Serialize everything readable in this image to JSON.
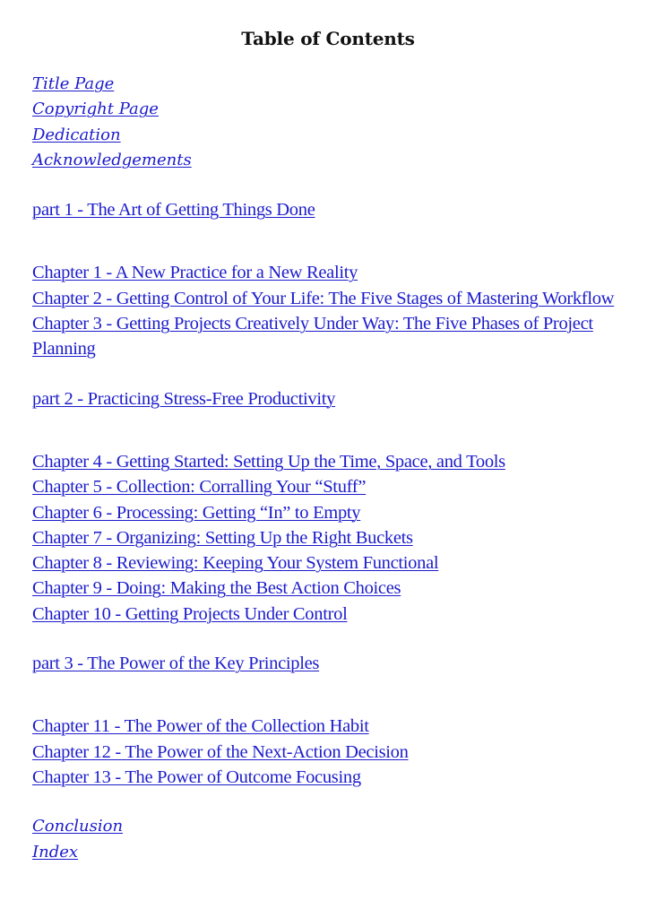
{
  "title": "Table of Contents",
  "link_color": "#1c1ccc",
  "front_matter": [
    "Title Page",
    "Copyright Page",
    "Dedication",
    "Acknowledgements"
  ],
  "parts": [
    {
      "label": "part 1 - The Art of Getting Things Done",
      "chapters": [
        "Chapter 1 - A New Practice for a New Reality",
        "Chapter 2 - Getting Control of Your Life: The Five Stages of Mastering Workflow",
        "Chapter 3 - Getting Projects Creatively Under Way: The Five Phases of Project Planning"
      ]
    },
    {
      "label": "part 2 - Practicing Stress-Free Productivity",
      "chapters": [
        "Chapter 4 - Getting Started: Setting Up the Time, Space, and Tools",
        "Chapter 5 - Collection: Corralling Your “Stuff”",
        "Chapter 6 - Processing: Getting “In” to Empty",
        "Chapter 7 - Organizing: Setting Up the Right Buckets",
        "Chapter 8 - Reviewing: Keeping Your System Functional",
        "Chapter 9 - Doing: Making the Best Action Choices",
        "Chapter 10 - Getting Projects Under Control"
      ]
    },
    {
      "label": "part 3 - The Power of the Key Principles",
      "chapters": [
        "Chapter 11 - The Power of the Collection Habit",
        "Chapter 12 - The Power of the Next-Action Decision",
        "Chapter 13 - The Power of Outcome Focusing"
      ]
    }
  ],
  "back_matter": [
    "Conclusion",
    "Index"
  ]
}
